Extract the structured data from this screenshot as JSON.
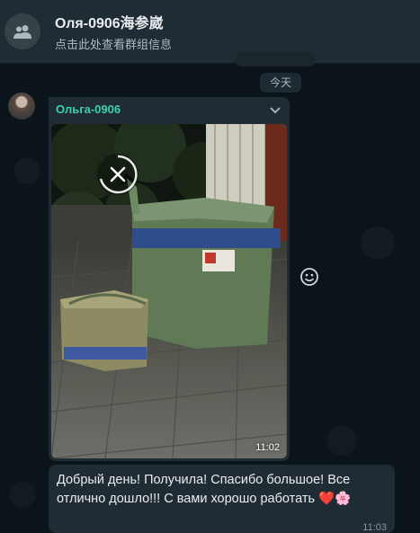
{
  "header": {
    "group_name": "Оля-0906海参崴",
    "subtitle": "点击此处查看群组信息",
    "avatar_icon": "group-icon"
  },
  "chat": {
    "date_separator": "今天",
    "messages": [
      {
        "sender": "Ольга-0906",
        "sender_color": "#3ccfb0",
        "type": "image",
        "time": "11:02",
        "overlay_icon": "cancel-download-icon"
      },
      {
        "type": "text",
        "text": "Добрый день! Получила! Спасибо большое! Все отлично дошло!!! С вами хорошо работать ❤️🌸",
        "time": "11:03"
      }
    ]
  },
  "icons": {
    "chevron": "chevron-down-icon",
    "emoji": "emoji-icon"
  },
  "colors": {
    "header_bg": "#202c33",
    "chat_bg": "#0b141a",
    "bubble_bg": "#202c33",
    "accent": "#3ccfb0"
  }
}
